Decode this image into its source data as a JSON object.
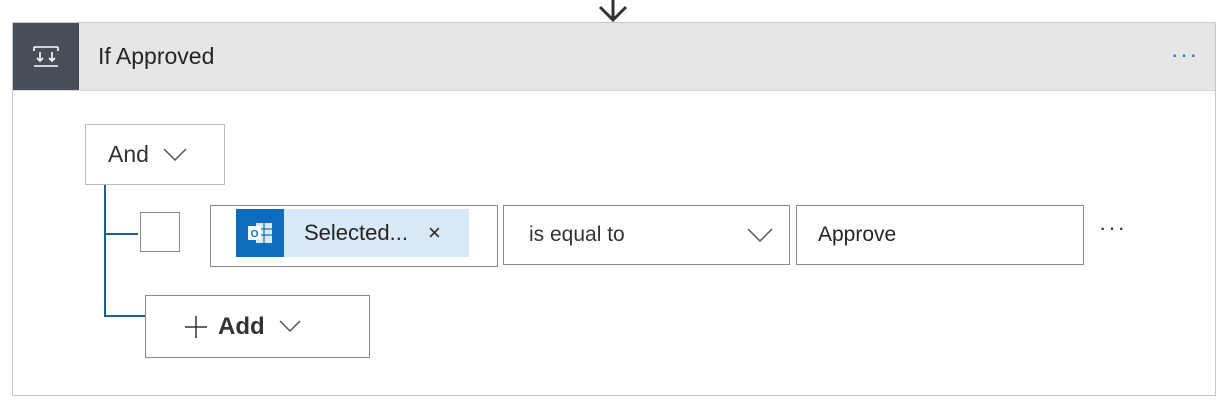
{
  "condition_card": {
    "title": "If Approved",
    "icon": "condition-icon",
    "more_icon": "ellipsis-icon"
  },
  "group": {
    "operator_label": "And",
    "chevron_icon": "chevron-down-icon"
  },
  "row": {
    "left_token_label": "Selected...",
    "left_token_icon": "outlook-icon",
    "left_token_remove_label": "×",
    "operator_label": "is equal to",
    "right_value": "Approve",
    "row_more_icon": "ellipsis-icon"
  },
  "add": {
    "label": "Add",
    "plus_icon": "plus-icon",
    "chevron_icon": "chevron-down-icon"
  },
  "colors": {
    "header_bg": "#e6e6e6",
    "header_icon_bg": "#484f58",
    "accent_blue": "#0f6cbd",
    "token_bg": "#d9e8f6",
    "tree_line": "#1f5d8f"
  }
}
